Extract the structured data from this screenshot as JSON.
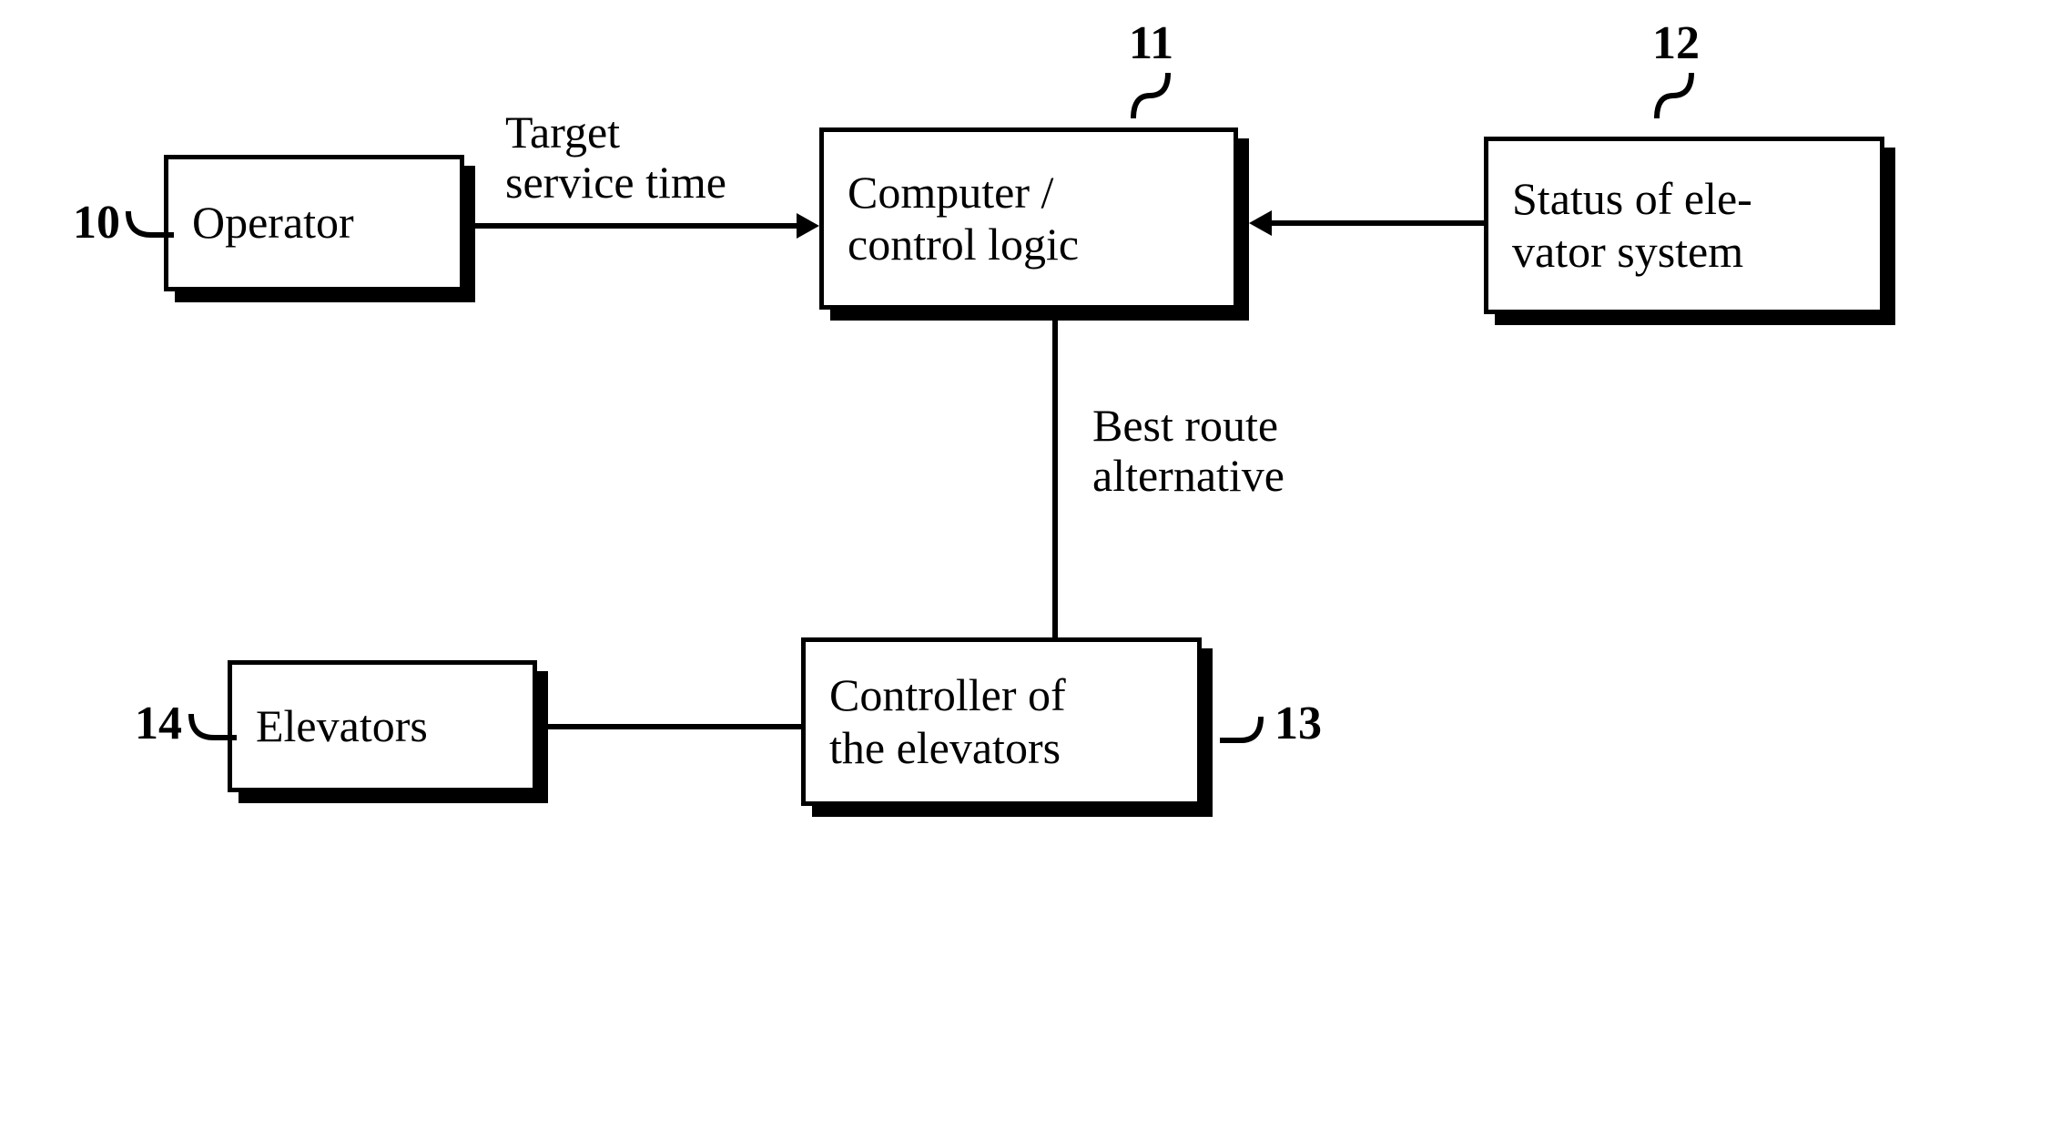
{
  "nodes": {
    "operator": {
      "label": "Operator",
      "ref": "10"
    },
    "computer": {
      "label": "Computer /\ncontrol logic",
      "ref": "11"
    },
    "status": {
      "label": "Status of ele-\nvator system",
      "ref": "12"
    },
    "controller": {
      "label": "Controller of\nthe elevators",
      "ref": "13"
    },
    "elevators": {
      "label": "Elevators",
      "ref": "14"
    }
  },
  "edges": {
    "op_to_comp": {
      "label": "Target\nservice time"
    },
    "status_to_comp": {
      "label": ""
    },
    "comp_to_ctrl": {
      "label": "Best route\nalternative"
    },
    "elev_to_ctrl": {
      "label": ""
    }
  }
}
